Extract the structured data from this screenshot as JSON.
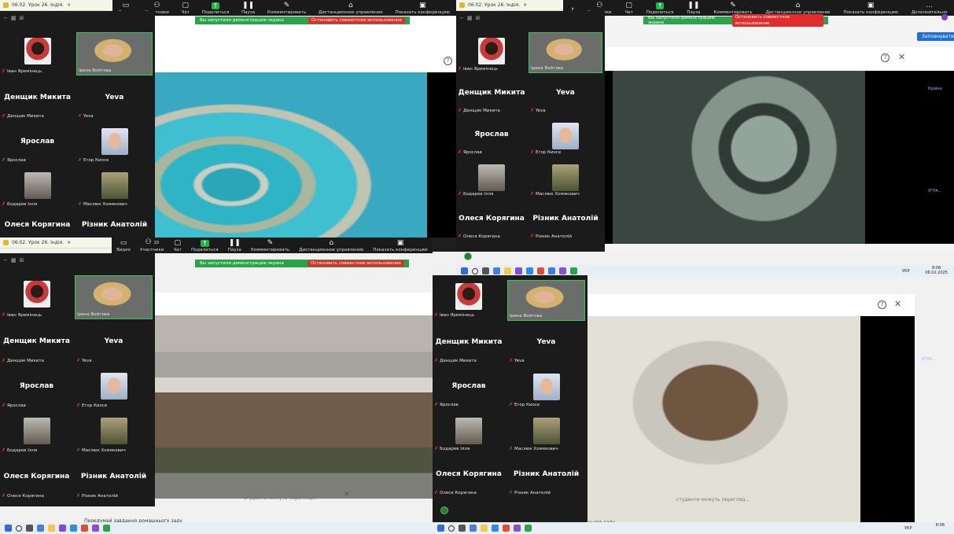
{
  "browser_tab": {
    "title": "06.02. Урок 26. Індія.",
    "close": "×"
  },
  "toolbar": {
    "items": [
      "Видео",
      "Участники",
      "Чат",
      "Поделиться",
      "Пауза",
      "Комментировать",
      "Дистанционное управление",
      "Показать конференцию"
    ],
    "participants_count": "10",
    "q2_more": "Дополнительно"
  },
  "share_banner": {
    "text": "Вы запустили демонстрацию экрана",
    "stop": "Остановить совместное использование"
  },
  "participants": [
    {
      "name": "Іван Яремінець",
      "type": "avatar"
    },
    {
      "name": "Ірина Войтова",
      "type": "video",
      "active": true
    },
    {
      "name": "Денщик Микита",
      "display": "Денщик Микита"
    },
    {
      "name": "Yeva",
      "display": "Yeva"
    },
    {
      "name": "Ярослав",
      "display": "Ярослав"
    },
    {
      "name": "Егор Киосе",
      "type": "avatar"
    },
    {
      "name": "Бодарев Ілля",
      "type": "avatar"
    },
    {
      "name": "Маслюк Хомякович",
      "type": "avatar"
    },
    {
      "name": "Олеся Корягина",
      "display": "Олеся Корягина"
    },
    {
      "name": "Різник Анатолій",
      "display": "Різник Анатолій"
    }
  ],
  "q2_extra": {
    "button": "Запланувати",
    "side_word": "Країна",
    "side_word2": "УГРА..."
  },
  "doc": {
    "row1": "студенти можуть перегляд...",
    "row2": "Передумай завдання домашнього заду"
  },
  "taskbar": {
    "lang": "УКР",
    "time": "8:06",
    "date": "06.02.2025"
  },
  "colors": {
    "active_border": "#34c759",
    "share_green": "#2aa34a",
    "stop_red": "#e02c2c",
    "mic_off": "#e34040"
  }
}
